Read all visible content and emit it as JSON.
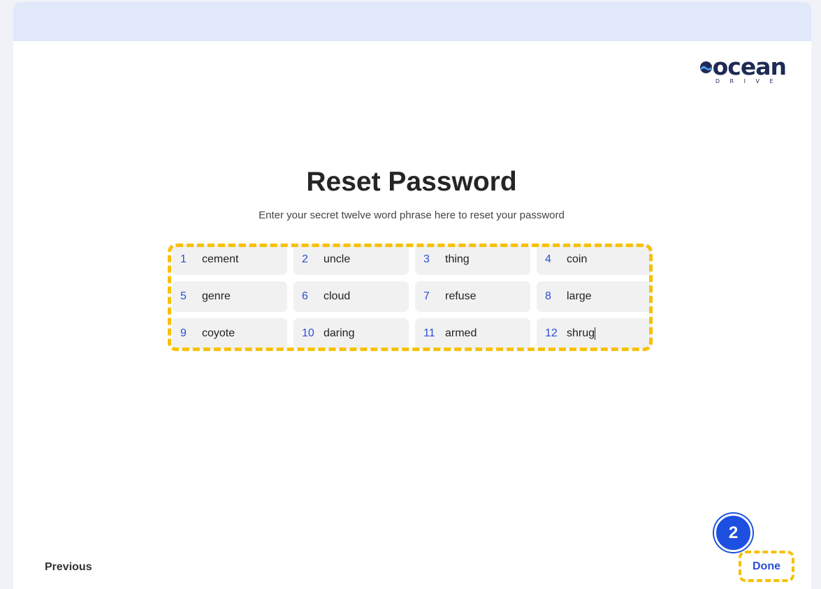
{
  "brand": {
    "name": "ocean",
    "tagline": "DRIVE"
  },
  "page": {
    "title": "Reset Password",
    "subtitle": "Enter your secret twelve word phrase here to reset your password"
  },
  "words": [
    {
      "num": "1",
      "word": "cement"
    },
    {
      "num": "2",
      "word": "uncle"
    },
    {
      "num": "3",
      "word": "thing"
    },
    {
      "num": "4",
      "word": "coin"
    },
    {
      "num": "5",
      "word": "genre"
    },
    {
      "num": "6",
      "word": "cloud"
    },
    {
      "num": "7",
      "word": "refuse"
    },
    {
      "num": "8",
      "word": "large"
    },
    {
      "num": "9",
      "word": "coyote"
    },
    {
      "num": "10",
      "word": "daring"
    },
    {
      "num": "11",
      "word": "armed"
    },
    {
      "num": "12",
      "word": "shrug"
    }
  ],
  "footer": {
    "previous_label": "Previous",
    "done_label": "Done"
  },
  "step_badge": "2",
  "colors": {
    "accent": "#2a4fd3",
    "highlight": "#f7c000",
    "badge": "#1d4fe0"
  }
}
